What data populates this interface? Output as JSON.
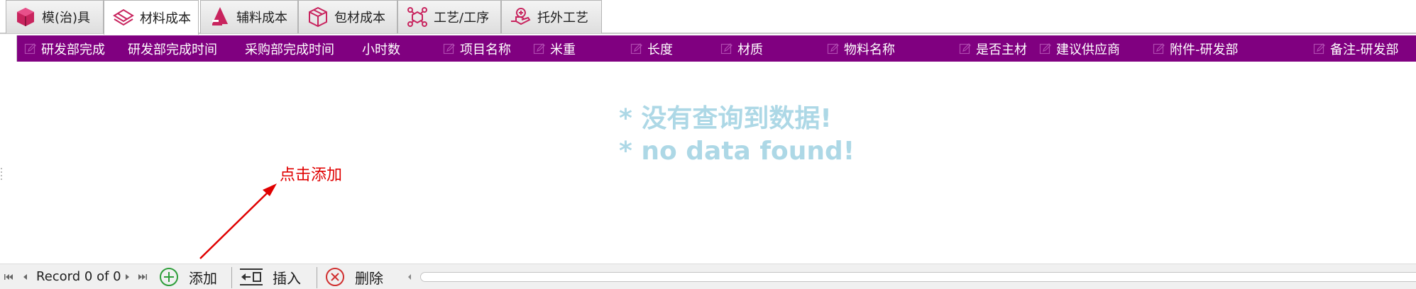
{
  "tabs": [
    {
      "label": "模(治)具",
      "icon": "cube-icon"
    },
    {
      "label": "材料成本",
      "icon": "materials-stack-icon"
    },
    {
      "label": "辅料成本",
      "icon": "auxiliary-material-icon"
    },
    {
      "label": "包材成本",
      "icon": "package-box-icon"
    },
    {
      "label": "工艺/工序",
      "icon": "process-nodes-icon"
    },
    {
      "label": "托外工艺",
      "icon": "outsourcing-hand-icon"
    }
  ],
  "active_tab": "材料成本",
  "grid": {
    "columns": [
      "研发部完成",
      "研发部完成时间",
      "采购部完成时间",
      "小时数",
      "项目名称",
      "米重",
      "长度",
      "材质",
      "物料名称",
      "是否主材",
      "建议供应商",
      "附件-研发部",
      "备注-研发部"
    ],
    "empty_message_cn": "* 没有查询到数据!",
    "empty_message_en": "* no data found!"
  },
  "annotation": {
    "text": "点击添加",
    "color": "#e00000"
  },
  "navigator": {
    "record_text": "Record 0 of 0",
    "add_label": "添加",
    "insert_label": "插入",
    "delete_label": "删除"
  },
  "colors": {
    "header_bg": "#800080",
    "nodata_text": "#add8e6",
    "add_icon": "#2e9e3a",
    "delete_icon": "#d03030"
  }
}
